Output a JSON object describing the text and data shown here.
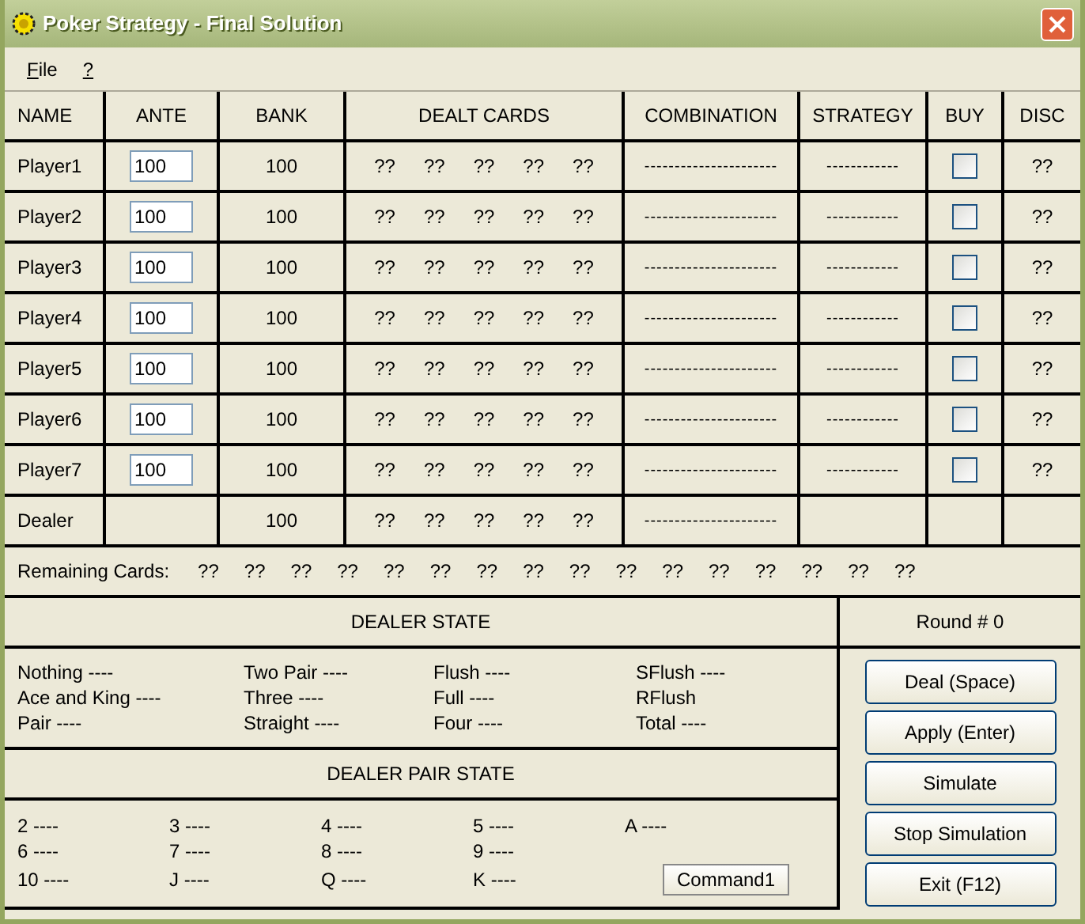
{
  "window": {
    "title": "Poker Strategy - Final Solution"
  },
  "menu": [
    "File",
    "?"
  ],
  "columns": [
    "NAME",
    "ANTE",
    "BANK",
    "DEALT CARDS",
    "COMBINATION",
    "STRATEGY",
    "BUY",
    "DISC"
  ],
  "players": [
    {
      "name": "Player1",
      "ante": "100",
      "bank": "100",
      "cards": [
        "??",
        "??",
        "??",
        "??",
        "??"
      ],
      "combination": "----------------------",
      "strategy": "------------",
      "buy": {
        "checked": false
      },
      "disc": "??"
    },
    {
      "name": "Player2",
      "ante": "100",
      "bank": "100",
      "cards": [
        "??",
        "??",
        "??",
        "??",
        "??"
      ],
      "combination": "----------------------",
      "strategy": "------------",
      "buy": {
        "checked": false
      },
      "disc": "??"
    },
    {
      "name": "Player3",
      "ante": "100",
      "bank": "100",
      "cards": [
        "??",
        "??",
        "??",
        "??",
        "??"
      ],
      "combination": "----------------------",
      "strategy": "------------",
      "buy": {
        "checked": false
      },
      "disc": "??"
    },
    {
      "name": "Player4",
      "ante": "100",
      "bank": "100",
      "cards": [
        "??",
        "??",
        "??",
        "??",
        "??"
      ],
      "combination": "----------------------",
      "strategy": "------------",
      "buy": {
        "checked": false
      },
      "disc": "??"
    },
    {
      "name": "Player5",
      "ante": "100",
      "bank": "100",
      "cards": [
        "??",
        "??",
        "??",
        "??",
        "??"
      ],
      "combination": "----------------------",
      "strategy": "------------",
      "buy": {
        "checked": false
      },
      "disc": "??"
    },
    {
      "name": "Player6",
      "ante": "100",
      "bank": "100",
      "cards": [
        "??",
        "??",
        "??",
        "??",
        "??"
      ],
      "combination": "----------------------",
      "strategy": "------------",
      "buy": {
        "checked": false
      },
      "disc": "??"
    },
    {
      "name": "Player7",
      "ante": "100",
      "bank": "100",
      "cards": [
        "??",
        "??",
        "??",
        "??",
        "??"
      ],
      "combination": "----------------------",
      "strategy": "------------",
      "buy": {
        "checked": false
      },
      "disc": "??"
    },
    {
      "name": "Dealer",
      "bank": "100",
      "cards": [
        "??",
        "??",
        "??",
        "??",
        "??"
      ],
      "combination": "----------------------"
    }
  ],
  "remaining": {
    "label": "Remaining Cards:",
    "cards": [
      "??",
      "??",
      "??",
      "??",
      "??",
      "??",
      "??",
      "??",
      "??",
      "??",
      "??",
      "??",
      "??",
      "??",
      "??",
      "??"
    ]
  },
  "dealer_state": {
    "title": "DEALER STATE",
    "items": [
      "Nothing ----",
      "Two Pair ----",
      "Flush ----",
      "SFlush ----",
      "Ace and King ----",
      "Three ----",
      "Full ----",
      "RFlush",
      "Pair ----",
      "Straight ----",
      "Four ----",
      "Total ----"
    ]
  },
  "dealer_pair_state": {
    "title": "DEALER PAIR STATE",
    "rows": [
      [
        "2 ----",
        "3 ----",
        "4 ----",
        "5 ----",
        "A ----"
      ],
      [
        "6 ----",
        "7 ----",
        "8 ----",
        "9 ----"
      ],
      [
        "10 ----",
        "J ----",
        "Q ----",
        "K ----"
      ]
    ],
    "command": "Command1"
  },
  "round": "Round # 0",
  "buttons": [
    "Deal (Space)",
    "Apply (Enter)",
    "Simulate",
    "Stop Simulation",
    "Exit (F12)"
  ]
}
